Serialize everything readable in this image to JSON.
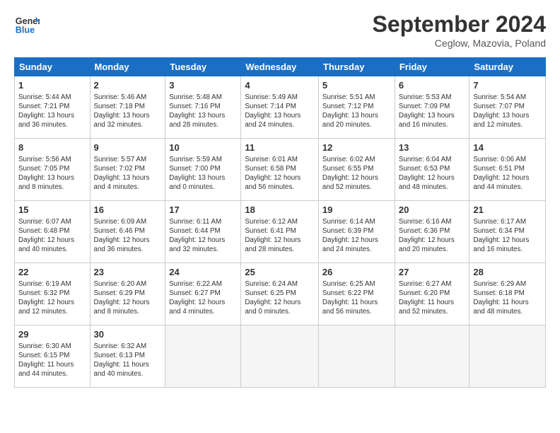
{
  "header": {
    "logo_line1": "General",
    "logo_line2": "Blue",
    "month_title": "September 2024",
    "subtitle": "Ceglow, Mazovia, Poland"
  },
  "days_of_week": [
    "Sunday",
    "Monday",
    "Tuesday",
    "Wednesday",
    "Thursday",
    "Friday",
    "Saturday"
  ],
  "weeks": [
    [
      {
        "day": "1",
        "info": "Sunrise: 5:44 AM\nSunset: 7:21 PM\nDaylight: 13 hours\nand 36 minutes."
      },
      {
        "day": "2",
        "info": "Sunrise: 5:46 AM\nSunset: 7:18 PM\nDaylight: 13 hours\nand 32 minutes."
      },
      {
        "day": "3",
        "info": "Sunrise: 5:48 AM\nSunset: 7:16 PM\nDaylight: 13 hours\nand 28 minutes."
      },
      {
        "day": "4",
        "info": "Sunrise: 5:49 AM\nSunset: 7:14 PM\nDaylight: 13 hours\nand 24 minutes."
      },
      {
        "day": "5",
        "info": "Sunrise: 5:51 AM\nSunset: 7:12 PM\nDaylight: 13 hours\nand 20 minutes."
      },
      {
        "day": "6",
        "info": "Sunrise: 5:53 AM\nSunset: 7:09 PM\nDaylight: 13 hours\nand 16 minutes."
      },
      {
        "day": "7",
        "info": "Sunrise: 5:54 AM\nSunset: 7:07 PM\nDaylight: 13 hours\nand 12 minutes."
      }
    ],
    [
      {
        "day": "8",
        "info": "Sunrise: 5:56 AM\nSunset: 7:05 PM\nDaylight: 13 hours\nand 8 minutes."
      },
      {
        "day": "9",
        "info": "Sunrise: 5:57 AM\nSunset: 7:02 PM\nDaylight: 13 hours\nand 4 minutes."
      },
      {
        "day": "10",
        "info": "Sunrise: 5:59 AM\nSunset: 7:00 PM\nDaylight: 13 hours\nand 0 minutes."
      },
      {
        "day": "11",
        "info": "Sunrise: 6:01 AM\nSunset: 6:58 PM\nDaylight: 12 hours\nand 56 minutes."
      },
      {
        "day": "12",
        "info": "Sunrise: 6:02 AM\nSunset: 6:55 PM\nDaylight: 12 hours\nand 52 minutes."
      },
      {
        "day": "13",
        "info": "Sunrise: 6:04 AM\nSunset: 6:53 PM\nDaylight: 12 hours\nand 48 minutes."
      },
      {
        "day": "14",
        "info": "Sunrise: 6:06 AM\nSunset: 6:51 PM\nDaylight: 12 hours\nand 44 minutes."
      }
    ],
    [
      {
        "day": "15",
        "info": "Sunrise: 6:07 AM\nSunset: 6:48 PM\nDaylight: 12 hours\nand 40 minutes."
      },
      {
        "day": "16",
        "info": "Sunrise: 6:09 AM\nSunset: 6:46 PM\nDaylight: 12 hours\nand 36 minutes."
      },
      {
        "day": "17",
        "info": "Sunrise: 6:11 AM\nSunset: 6:44 PM\nDaylight: 12 hours\nand 32 minutes."
      },
      {
        "day": "18",
        "info": "Sunrise: 6:12 AM\nSunset: 6:41 PM\nDaylight: 12 hours\nand 28 minutes."
      },
      {
        "day": "19",
        "info": "Sunrise: 6:14 AM\nSunset: 6:39 PM\nDaylight: 12 hours\nand 24 minutes."
      },
      {
        "day": "20",
        "info": "Sunrise: 6:16 AM\nSunset: 6:36 PM\nDaylight: 12 hours\nand 20 minutes."
      },
      {
        "day": "21",
        "info": "Sunrise: 6:17 AM\nSunset: 6:34 PM\nDaylight: 12 hours\nand 16 minutes."
      }
    ],
    [
      {
        "day": "22",
        "info": "Sunrise: 6:19 AM\nSunset: 6:32 PM\nDaylight: 12 hours\nand 12 minutes."
      },
      {
        "day": "23",
        "info": "Sunrise: 6:20 AM\nSunset: 6:29 PM\nDaylight: 12 hours\nand 8 minutes."
      },
      {
        "day": "24",
        "info": "Sunrise: 6:22 AM\nSunset: 6:27 PM\nDaylight: 12 hours\nand 4 minutes."
      },
      {
        "day": "25",
        "info": "Sunrise: 6:24 AM\nSunset: 6:25 PM\nDaylight: 12 hours\nand 0 minutes."
      },
      {
        "day": "26",
        "info": "Sunrise: 6:25 AM\nSunset: 6:22 PM\nDaylight: 11 hours\nand 56 minutes."
      },
      {
        "day": "27",
        "info": "Sunrise: 6:27 AM\nSunset: 6:20 PM\nDaylight: 11 hours\nand 52 minutes."
      },
      {
        "day": "28",
        "info": "Sunrise: 6:29 AM\nSunset: 6:18 PM\nDaylight: 11 hours\nand 48 minutes."
      }
    ],
    [
      {
        "day": "29",
        "info": "Sunrise: 6:30 AM\nSunset: 6:15 PM\nDaylight: 11 hours\nand 44 minutes."
      },
      {
        "day": "30",
        "info": "Sunrise: 6:32 AM\nSunset: 6:13 PM\nDaylight: 11 hours\nand 40 minutes."
      },
      {
        "day": "",
        "info": ""
      },
      {
        "day": "",
        "info": ""
      },
      {
        "day": "",
        "info": ""
      },
      {
        "day": "",
        "info": ""
      },
      {
        "day": "",
        "info": ""
      }
    ]
  ]
}
